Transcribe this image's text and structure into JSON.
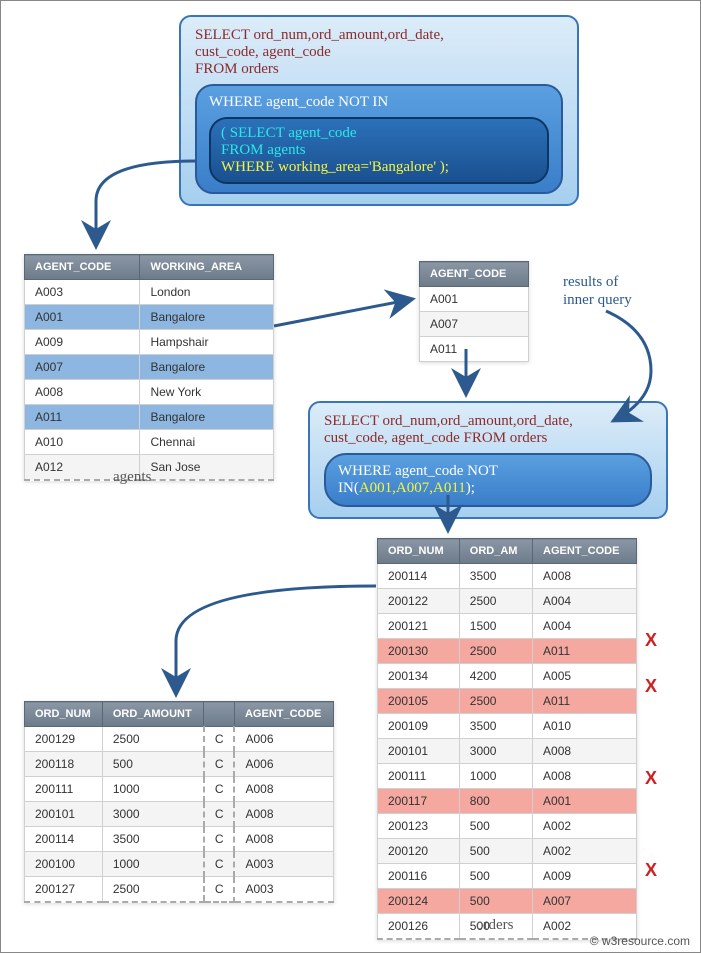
{
  "query1": {
    "line1": "SELECT ord_num,ord_amount,ord_date,",
    "line2": "cust_code, agent_code",
    "line3": "FROM orders",
    "mid": "WHERE agent_code NOT IN",
    "inner1": "( SELECT agent_code",
    "inner2": "FROM agents",
    "inner3": "WHERE working_area='Bangalore' );"
  },
  "query2": {
    "line1": "SELECT ord_num,ord_amount,ord_date,",
    "line2": "cust_code, agent_code FROM orders",
    "midA": "WHERE agent_code NOT IN(",
    "midB": "A001,A007,A011",
    "midC": ");"
  },
  "agents": {
    "caption": "agents",
    "headers": [
      "AGENT_CODE",
      "WORKING_AREA"
    ],
    "rows": [
      {
        "code": "A003",
        "area": "London",
        "hl": false
      },
      {
        "code": "A001",
        "area": "Bangalore",
        "hl": true
      },
      {
        "code": "A009",
        "area": "Hampshair",
        "hl": false
      },
      {
        "code": "A007",
        "area": "Bangalore",
        "hl": true
      },
      {
        "code": "A008",
        "area": "New York",
        "hl": false
      },
      {
        "code": "A011",
        "area": "Bangalore",
        "hl": true
      },
      {
        "code": "A010",
        "area": "Chennai",
        "hl": false
      },
      {
        "code": "A012",
        "area": "San Jose",
        "hl": false
      }
    ]
  },
  "inner_result": {
    "header": "AGENT_CODE",
    "rows": [
      "A001",
      "A007",
      "A011"
    ],
    "label1": "results of",
    "label2": "inner query"
  },
  "orders": {
    "caption": "orders",
    "headers": [
      "ORD_NUM",
      "ORD_AM",
      "AGENT_CODE"
    ],
    "rows": [
      {
        "n": "200114",
        "a": "3500",
        "g": "A008",
        "x": false
      },
      {
        "n": "200122",
        "a": "2500",
        "g": "A004",
        "x": false
      },
      {
        "n": "200121",
        "a": "1500",
        "g": "A004",
        "x": false
      },
      {
        "n": "200130",
        "a": "2500",
        "g": "A011",
        "x": true
      },
      {
        "n": "200134",
        "a": "4200",
        "g": "A005",
        "x": false
      },
      {
        "n": "200105",
        "a": "2500",
        "g": "A011",
        "x": true
      },
      {
        "n": "200109",
        "a": "3500",
        "g": "A010",
        "x": false
      },
      {
        "n": "200101",
        "a": "3000",
        "g": "A008",
        "x": false
      },
      {
        "n": "200111",
        "a": "1000",
        "g": "A008",
        "x": false
      },
      {
        "n": "200117",
        "a": "800",
        "g": "A001",
        "x": true
      },
      {
        "n": "200123",
        "a": "500",
        "g": "A002",
        "x": false
      },
      {
        "n": "200120",
        "a": "500",
        "g": "A002",
        "x": false
      },
      {
        "n": "200116",
        "a": "500",
        "g": "A009",
        "x": false
      },
      {
        "n": "200124",
        "a": "500",
        "g": "A007",
        "x": true
      },
      {
        "n": "200126",
        "a": "500",
        "g": "A002",
        "x": false
      }
    ]
  },
  "final": {
    "headers": [
      "ORD_NUM",
      "ORD_AMOUNT",
      "",
      "AGENT_CODE"
    ],
    "rows": [
      {
        "n": "200129",
        "a": "2500",
        "c": "C",
        "g": "A006"
      },
      {
        "n": "200118",
        "a": "500",
        "c": "C",
        "g": "A006"
      },
      {
        "n": "200111",
        "a": "1000",
        "c": "C",
        "g": "A008"
      },
      {
        "n": "200101",
        "a": "3000",
        "c": "C",
        "g": "A008"
      },
      {
        "n": "200114",
        "a": "3500",
        "c": "C",
        "g": "A008"
      },
      {
        "n": "200100",
        "a": "1000",
        "c": "C",
        "g": "A003"
      },
      {
        "n": "200127",
        "a": "2500",
        "c": "C",
        "g": "A003"
      }
    ]
  },
  "attribution": "© w3resource.com"
}
